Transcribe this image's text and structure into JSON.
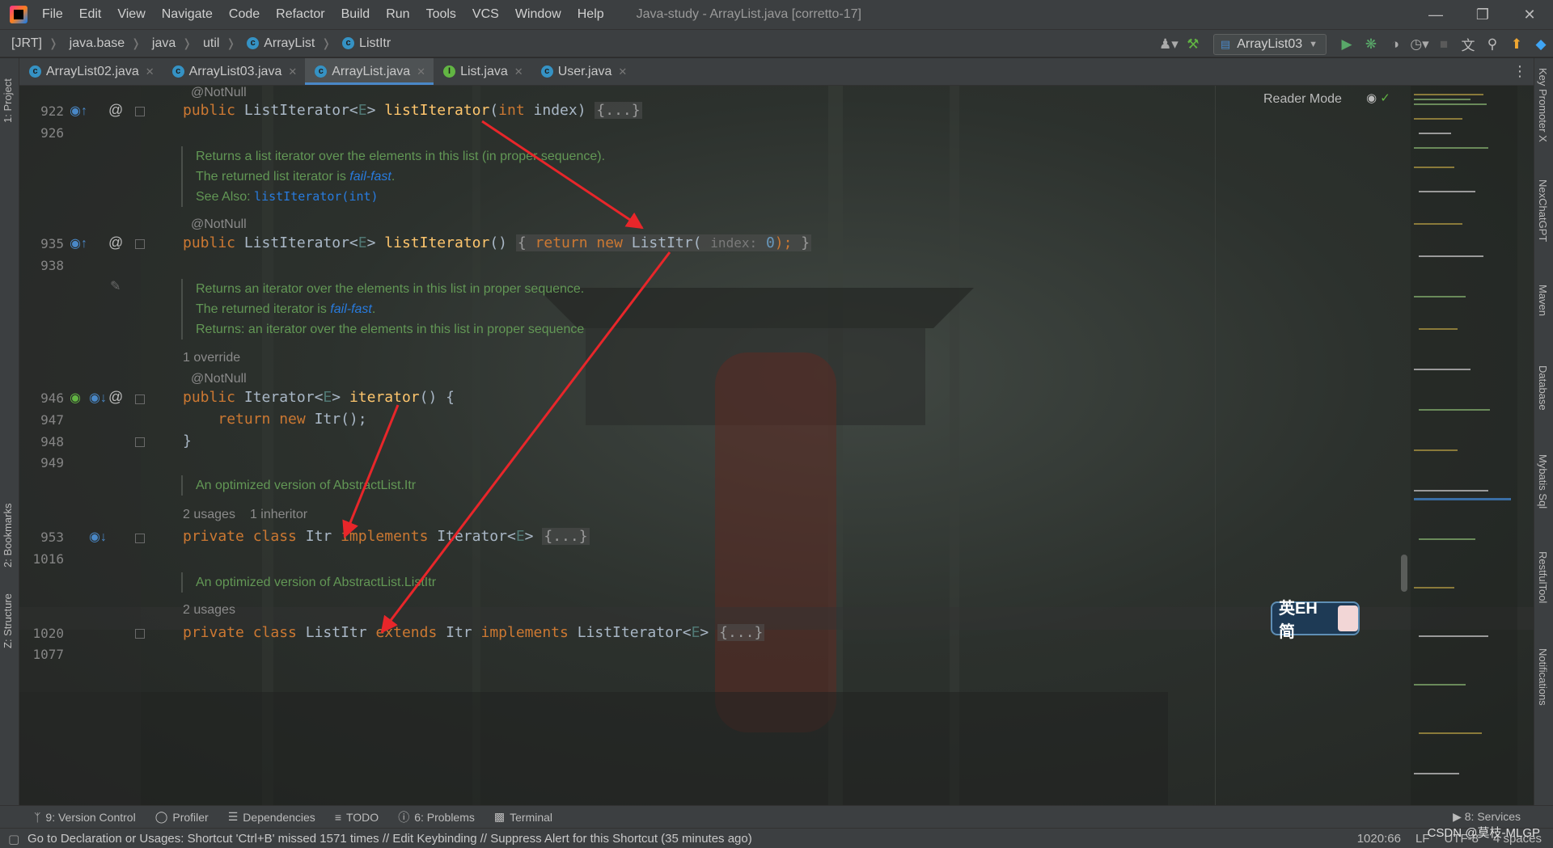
{
  "menu": {
    "items": [
      "File",
      "Edit",
      "View",
      "Navigate",
      "Code",
      "Refactor",
      "Build",
      "Run",
      "Tools",
      "VCS",
      "Window",
      "Help"
    ],
    "window_title": "Java-study - ArrayList.java [corretto-17]"
  },
  "nav": {
    "crumbs": [
      "[JRT]",
      "java.base",
      "java",
      "util",
      "ArrayList",
      "ListItr"
    ],
    "run_config": "ArrayList03"
  },
  "tabs": [
    {
      "label": "ArrayList02.java",
      "kind": "class"
    },
    {
      "label": "ArrayList03.java",
      "kind": "class"
    },
    {
      "label": "ArrayList.java",
      "kind": "class",
      "active": true
    },
    {
      "label": "List.java",
      "kind": "interface"
    },
    {
      "label": "User.java",
      "kind": "class"
    }
  ],
  "left_tools": {
    "project": "1: Project",
    "bookmarks": "2: Bookmarks",
    "structure": "Z: Structure"
  },
  "right_tools": [
    "Key Promoter X",
    "NexChatGPT",
    "Maven",
    "Database",
    "Mybatis Sql",
    "RestfulTool",
    "Notifications"
  ],
  "editor": {
    "reader_mode": "Reader Mode",
    "line_numbers": [
      "922",
      "926",
      "935",
      "938",
      "946",
      "947",
      "948",
      "949",
      "953",
      "1016",
      "1020",
      "1077"
    ],
    "ann1": "@NotNull",
    "ann2": "@NotNull",
    "ann3": "@NotNull",
    "doc1": {
      "line1": "Returns a list iterator over the elements in this list (in proper sequence).",
      "line2_pre": "The returned list iterator is ",
      "line2_link": "fail-fast",
      "line2_post": ".",
      "see_label": "See Also: ",
      "see_link": "listIterator(int)"
    },
    "doc2": {
      "line1": "Returns an iterator over the elements in this list in proper sequence.",
      "line2_pre": "The returned iterator is ",
      "line2_link": "fail-fast",
      "line2_post": ".",
      "returns": "Returns: an iterator over the elements in this list in proper sequence"
    },
    "doc3": "An optimized version of AbstractList.Itr",
    "doc4": "An optimized version of AbstractList.ListItr",
    "override_lens": "1 override",
    "itr_usages": "2 usages",
    "itr_inheritors": "1 inheritor",
    "listitr_usages": "2 usages",
    "param_hint": "index:"
  },
  "bottom_tools": [
    {
      "label": "9: Version Control",
      "icon": "branch-icon"
    },
    {
      "label": "Profiler",
      "icon": "profiler-icon"
    },
    {
      "label": "Dependencies",
      "icon": "dependencies-icon"
    },
    {
      "label": "TODO",
      "icon": "list-icon"
    },
    {
      "label": "6: Problems",
      "icon": "info-icon"
    },
    {
      "label": "Terminal",
      "icon": "terminal-icon"
    }
  ],
  "services_label": "8: Services",
  "ime": {
    "text": "英EH 简"
  },
  "status": {
    "message": "Go to Declaration or Usages: Shortcut 'Ctrl+B' missed 1571 times // Edit Keybinding // Suppress Alert for this Shortcut (35 minutes ago)",
    "position": "1020:66",
    "line_sep": "LF",
    "encoding": "UTF-8",
    "indent": "4 spaces",
    "watermark": "CSDN @莫枝-MLGP"
  },
  "colors": {
    "accent": "#4a88c7",
    "arrow": "#e8262a",
    "keyword": "#cc7832",
    "method": "#ffc66d",
    "doc": "#629755"
  }
}
